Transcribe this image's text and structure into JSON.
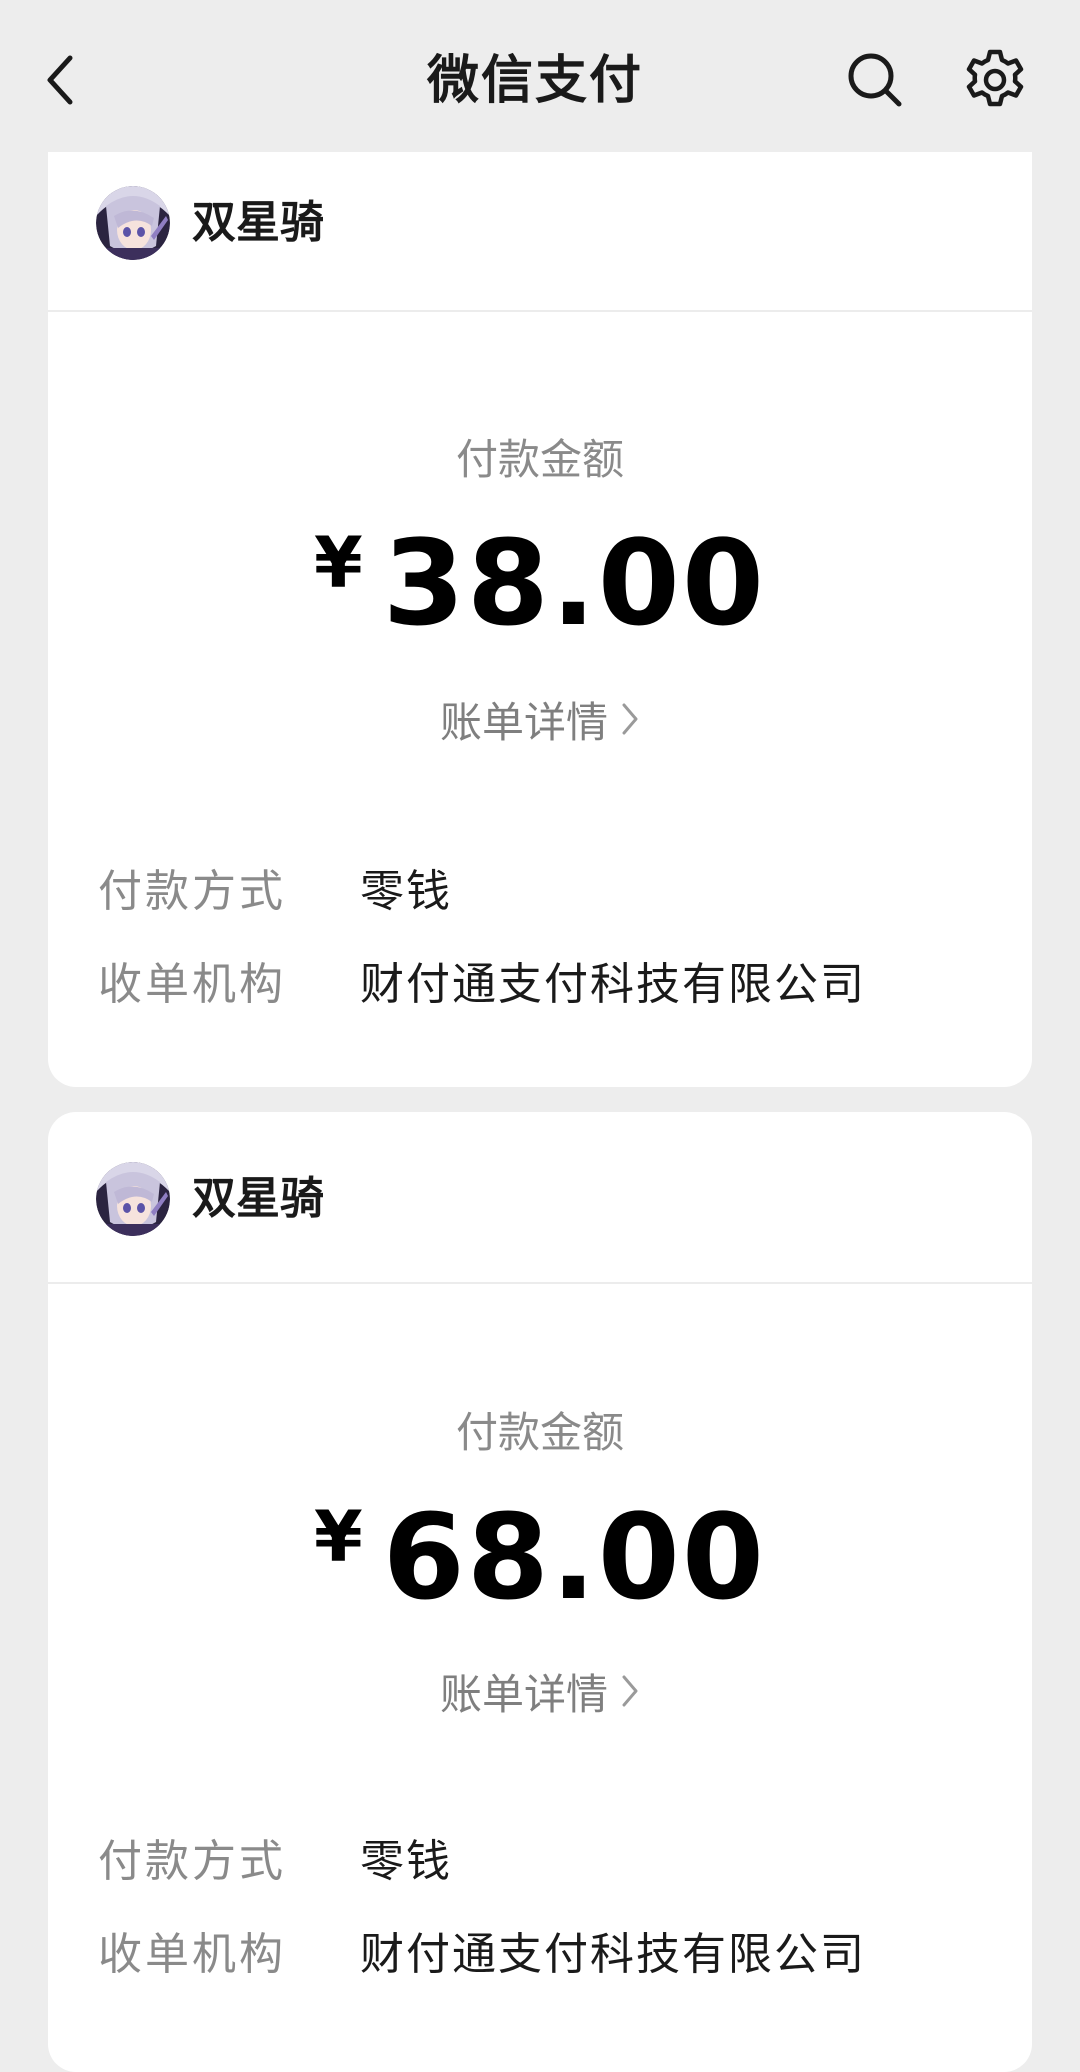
{
  "header": {
    "title": "微信支付",
    "icons": {
      "back": "chevron-left-icon",
      "search": "search-icon",
      "settings": "gear-icon"
    }
  },
  "payments": [
    {
      "merchant": "双星骑",
      "amount_label": "付款金额",
      "currency": "¥",
      "amount": "38.00",
      "detail_link": "账单详情",
      "method_label": "付款方式",
      "method_value": "零钱",
      "acquirer_label": "收单机构",
      "acquirer_value": "财付通支付科技有限公司"
    },
    {
      "merchant": "双星骑",
      "amount_label": "付款金额",
      "currency": "¥",
      "amount": "68.00",
      "detail_link": "账单详情",
      "method_label": "付款方式",
      "method_value": "零钱",
      "acquirer_label": "收单机构",
      "acquirer_value": "财付通支付科技有限公司"
    }
  ],
  "colors": {
    "background": "#ededed",
    "card": "#ffffff",
    "primary_text": "#1a1a1a",
    "secondary_text": "#8a8a8a"
  }
}
